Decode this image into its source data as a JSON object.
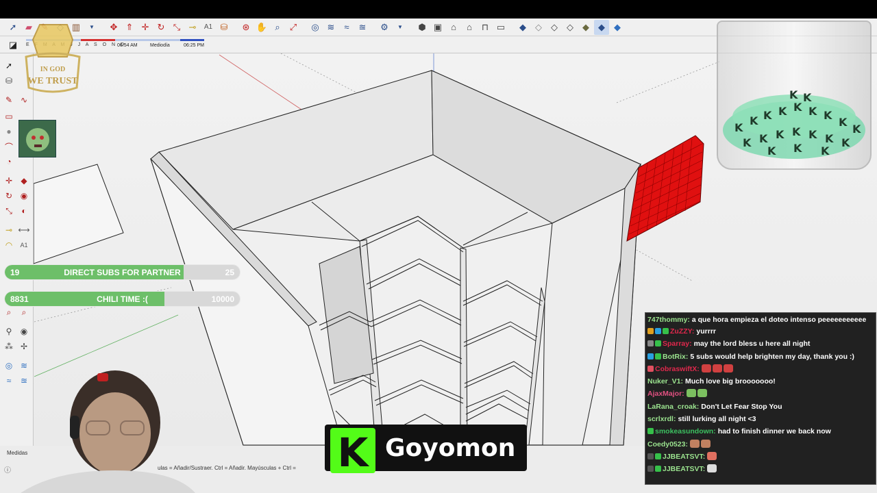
{
  "toolbar": {
    "shadow_months": "E F M A M J J A S O N D",
    "time_start": "06:54 AM",
    "time_mid": "Mediodía",
    "time_end": "06:25 PM"
  },
  "status": {
    "measures_label": "Medidas",
    "hint": "ulas = Añadir/Sustraer. Ctrl = Añadir. Mayúsculas + Ctrl ="
  },
  "logo": {
    "line1": "IN GOD",
    "line2": "WE TRUST"
  },
  "goals": [
    {
      "current": "19",
      "name": "DIRECT SUBS FOR PARTNER",
      "target": "25",
      "progress": 0.76
    },
    {
      "current": "8831",
      "name": "CHILI TIME :(",
      "target": "10000",
      "progress": 0.68
    }
  ],
  "streamer": {
    "name": "Goyomon",
    "kick_letter": "K"
  },
  "chat": [
    {
      "user": "747thommy:",
      "user_color": "#9be38f",
      "text": "a que hora empieza el doteo intenso peeeeeeeeeee",
      "badges": []
    },
    {
      "user": "ZuZZY:",
      "user_color": "#e0284c",
      "text": "yurrrr",
      "badges": [
        "#e0a020",
        "#2aa0e0",
        "#36c04a"
      ]
    },
    {
      "user": "Sparray:",
      "user_color": "#e0284c",
      "text": "may the lord bless u here all night",
      "badges": [
        "#888888",
        "#36c04a"
      ]
    },
    {
      "user": "BotRix:",
      "user_color": "#9be38f",
      "text": "5 subs would help brighten my day, thank you :)",
      "badges": [
        "#2aa0e0",
        "#36c04a"
      ]
    },
    {
      "user": "CobraswiftX:",
      "user_color": "#e0284c",
      "text": "",
      "badges": [
        "#e05060"
      ],
      "emotes": [
        "#d04040",
        "#d04040",
        "#d04040"
      ]
    },
    {
      "user": "Nuker_V1:",
      "user_color": "#9be38f",
      "text": "Much love big brooooooo!",
      "badges": []
    },
    {
      "user": "AjaxMajor:",
      "user_color": "#e05080",
      "text": "",
      "badges": [],
      "emotes": [
        "#7cc060",
        "#7cc060"
      ]
    },
    {
      "user": "LaRana_croak:",
      "user_color": "#9be38f",
      "text": "Don't Let Fear Stop You",
      "badges": []
    },
    {
      "user": "scrlxrdl:",
      "user_color": "#9be38f",
      "text": "still lurking all night <3",
      "badges": []
    },
    {
      "user": "smokeasundown:",
      "user_color": "#3cc060",
      "text": "had to finish dinner we back now",
      "badges": [
        "#36c04a"
      ]
    },
    {
      "user": "Coedy0523:",
      "user_color": "#9be38f",
      "text": "",
      "badges": [],
      "emotes": [
        "#c08060",
        "#c08060"
      ]
    },
    {
      "user": "JJBEATSVT:",
      "user_color": "#9be38f",
      "text": "",
      "badges": [
        "#555555",
        "#36c04a"
      ],
      "emotes": [
        "#e07060"
      ]
    },
    {
      "user": "JJBEATSVT:",
      "user_color": "#9be38f",
      "text": "",
      "badges": [
        "#555555",
        "#36c04a"
      ],
      "emotes": [
        "#dddddd"
      ]
    }
  ],
  "colors": {
    "goal_fill": "#6dbf69",
    "kick_green": "#53fc18",
    "red_grid": "#e01010"
  }
}
